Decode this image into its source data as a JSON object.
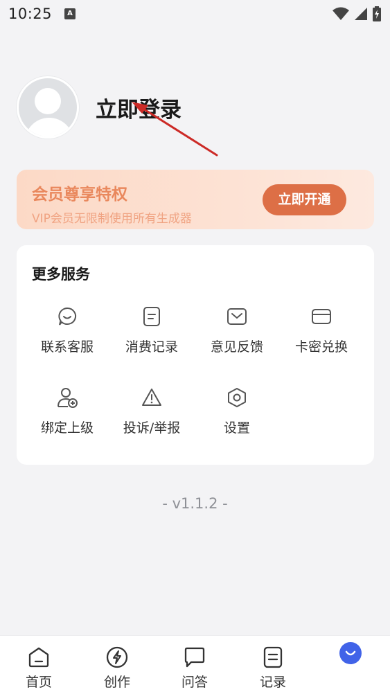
{
  "status_bar": {
    "time": "10:25",
    "indicator": "A",
    "icons": [
      "wifi-icon",
      "signal-icon",
      "battery-icon"
    ]
  },
  "profile": {
    "avatar_icon": "avatar-placeholder-icon",
    "login_label": "立即登录"
  },
  "vip": {
    "title": "会员尊享特权",
    "subtitle": "VIP会员无限制使用所有生成器",
    "button_label": "立即开通",
    "colors": {
      "title": "#e9885d",
      "button": "#dd6f46"
    }
  },
  "services": {
    "title": "更多服务",
    "items": [
      {
        "label": "联系客服",
        "icon": "chat-smile-icon"
      },
      {
        "label": "消费记录",
        "icon": "document-icon"
      },
      {
        "label": "意见反馈",
        "icon": "mail-icon"
      },
      {
        "label": "卡密兑换",
        "icon": "card-icon"
      },
      {
        "label": "绑定上级",
        "icon": "user-add-icon"
      },
      {
        "label": "投诉/举报",
        "icon": "warning-icon"
      },
      {
        "label": "设置",
        "icon": "settings-hex-icon"
      }
    ]
  },
  "version": "- v1.1.2 -",
  "tabbar": {
    "items": [
      {
        "label": "首页",
        "icon": "home-icon"
      },
      {
        "label": "创作",
        "icon": "lightning-icon"
      },
      {
        "label": "问答",
        "icon": "message-icon"
      },
      {
        "label": "记录",
        "icon": "list-doc-icon"
      },
      {
        "label": "",
        "icon": "smile-mine-icon"
      }
    ],
    "active_color": "#4163e8"
  }
}
